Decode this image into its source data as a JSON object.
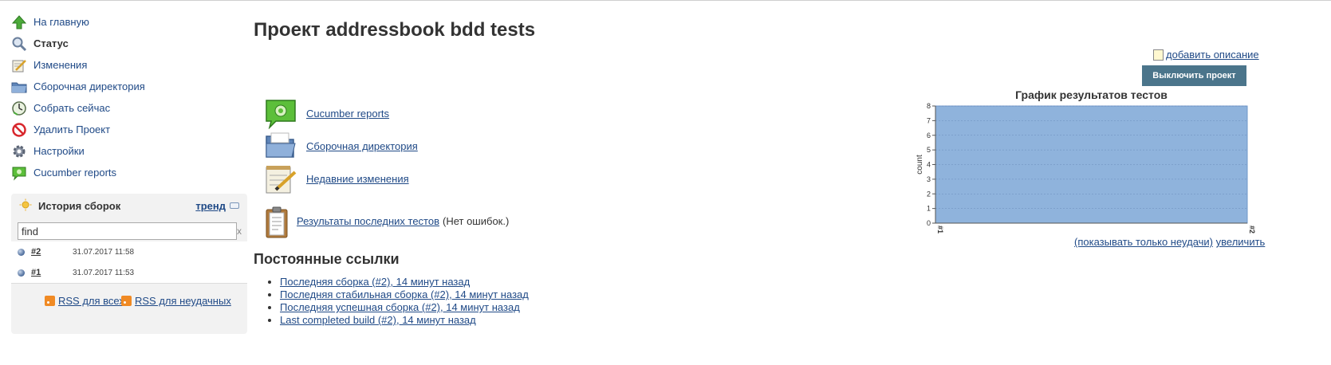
{
  "sidebar": {
    "items": [
      {
        "label": "На главную",
        "icon": "up-arrow-icon"
      },
      {
        "label": "Статус",
        "icon": "magnifier-icon"
      },
      {
        "label": "Изменения",
        "icon": "notepad-icon"
      },
      {
        "label": "Сборочная директория",
        "icon": "folder-icon"
      },
      {
        "label": "Собрать сейчас",
        "icon": "clock-icon"
      },
      {
        "label": "Удалить Проект",
        "icon": "no-entry-icon"
      },
      {
        "label": "Настройки",
        "icon": "gear-icon"
      },
      {
        "label": "Cucumber reports",
        "icon": "cucumber-icon"
      }
    ]
  },
  "build_history": {
    "title": "История сборок",
    "trend_label": "тренд",
    "search_value": "find",
    "clear_label": "x",
    "builds": [
      {
        "number": "#2",
        "date": "31.07.2017 11:58",
        "status": "success"
      },
      {
        "number": "#1",
        "date": "31.07.2017 11:53",
        "status": "success"
      }
    ],
    "rss_all": "RSS для всех",
    "rss_failed": "RSS для неудачных"
  },
  "main": {
    "title": "Проект addressbook bdd tests",
    "add_description": "добавить описание",
    "disable_button": "Выключить проект",
    "links": {
      "cucumber": "Cucumber reports",
      "workspace": "Сборочная директория",
      "changes": "Недавние изменения",
      "test_results": "Результаты последних тестов",
      "no_errors": "(Нет ошибок.)"
    },
    "permalinks_title": "Постоянные ссылки",
    "permalinks": [
      "Последняя сборка (#2), 14 минут назад",
      "Последняя стабильная сборка (#2), 14 минут назад",
      "Последняя успешная сборка (#2), 14 минут назад",
      "Last completed build (#2), 14 минут назад"
    ],
    "chart_links": {
      "only_failures": "(показывать только неудачи)",
      "enlarge": "увеличить"
    }
  },
  "colors": {
    "link": "#204a87",
    "button": "#4b758b",
    "chart_fill": "#8fb3dc",
    "chart_line": "#6f97c9"
  },
  "chart_data": {
    "type": "area",
    "title": "График результатов тестов",
    "xlabel": "",
    "ylabel": "count",
    "categories": [
      "#1",
      "#2"
    ],
    "series": [
      {
        "values": [
          8,
          8
        ]
      }
    ],
    "ylim": [
      0,
      8
    ],
    "yticks": [
      0,
      1,
      2,
      3,
      4,
      5,
      6,
      7,
      8
    ],
    "grid": true
  }
}
